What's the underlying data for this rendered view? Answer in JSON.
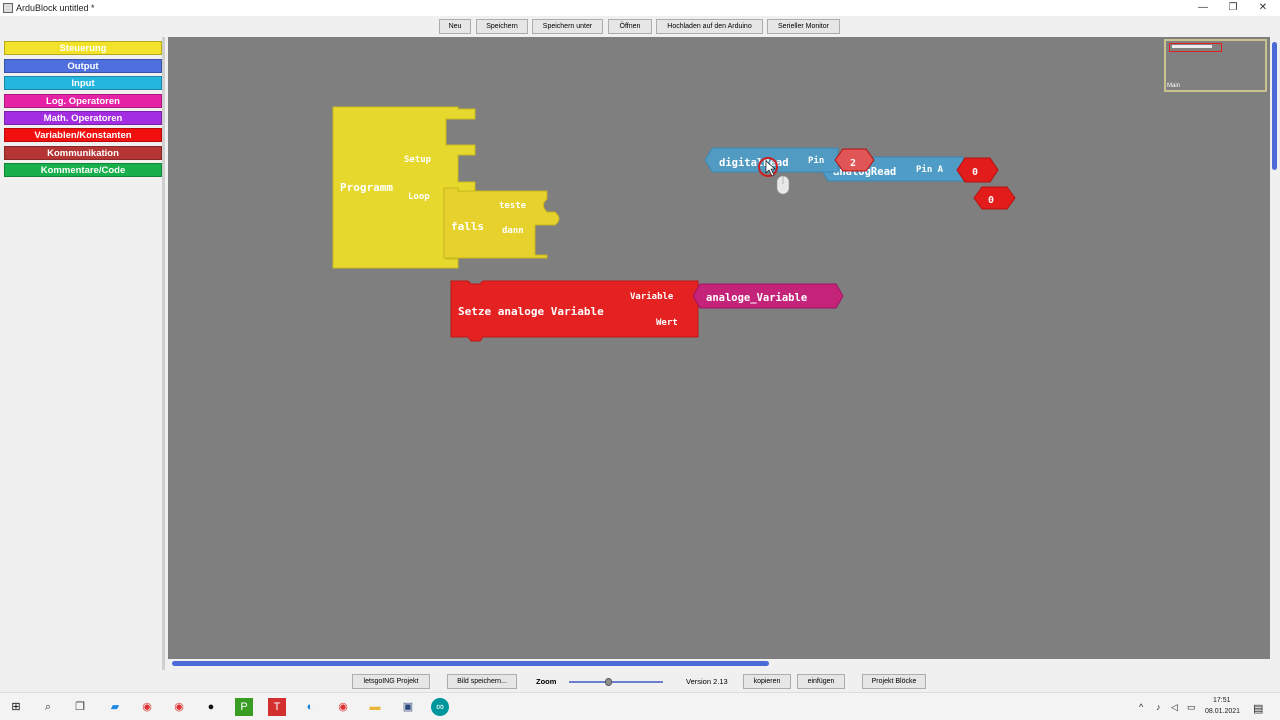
{
  "window": {
    "title": "ArduBlock untitled *",
    "minimize": "—",
    "maximize": "❐",
    "close": "✕"
  },
  "toolbar": {
    "buttons": [
      "Neu",
      "Speichern",
      "Speichern unter",
      "Öffnen",
      "Hochladen auf den Arduino",
      "Serieller Monitor"
    ]
  },
  "sidebar": {
    "categories": [
      {
        "label": "Steuerung",
        "color": "#f2e32a"
      },
      {
        "label": "Output",
        "color": "#4f6fde"
      },
      {
        "label": "Input",
        "color": "#25b6e0"
      },
      {
        "label": "Log. Operatoren",
        "color": "#e521a6"
      },
      {
        "label": "Math. Operatoren",
        "color": "#a32ee1"
      },
      {
        "label": "Variablen/Konstanten",
        "color": "#f20f0f"
      },
      {
        "label": "Kommunikation",
        "color": "#b53434"
      },
      {
        "label": "Kommentare/Code",
        "color": "#18b04c"
      }
    ]
  },
  "canvas": {
    "minimap_label": "Main",
    "blocks": {
      "programm": {
        "label": "Programm",
        "setup": "Setup",
        "loop": "Loop",
        "color": "#e6d82d"
      },
      "falls": {
        "label": "falls",
        "teste": "teste",
        "dann": "dann",
        "color": "#e6d12d"
      },
      "digitalread": {
        "label": "digitalRead",
        "pin": "Pin",
        "value": "2",
        "color": "#4f9cc6"
      },
      "analogread": {
        "label": "analogRead",
        "pin": "Pin A",
        "value": "0",
        "color": "#4f9cc6"
      },
      "number": {
        "value": "0",
        "color": "#e21b1b"
      },
      "setze": {
        "label": "Setze analoge Variable",
        "variable": "Variable",
        "wert": "Wert",
        "color": "#e52222"
      },
      "analoge_variable": {
        "label": "analoge_Variable",
        "color": "#c4237a"
      }
    }
  },
  "bottombar": {
    "project_button": "letsgoING Projekt",
    "save_image_button": "Bild speichern...",
    "zoom_label": "Zoom",
    "zoom_level": 0.4,
    "version": "Version 2.13",
    "copy_button": "kopieren",
    "paste_button": "einfügen",
    "blocks_button": "Projekt Blöcke"
  },
  "taskbar": {
    "time": "17:51",
    "date": "08.01.2021"
  }
}
